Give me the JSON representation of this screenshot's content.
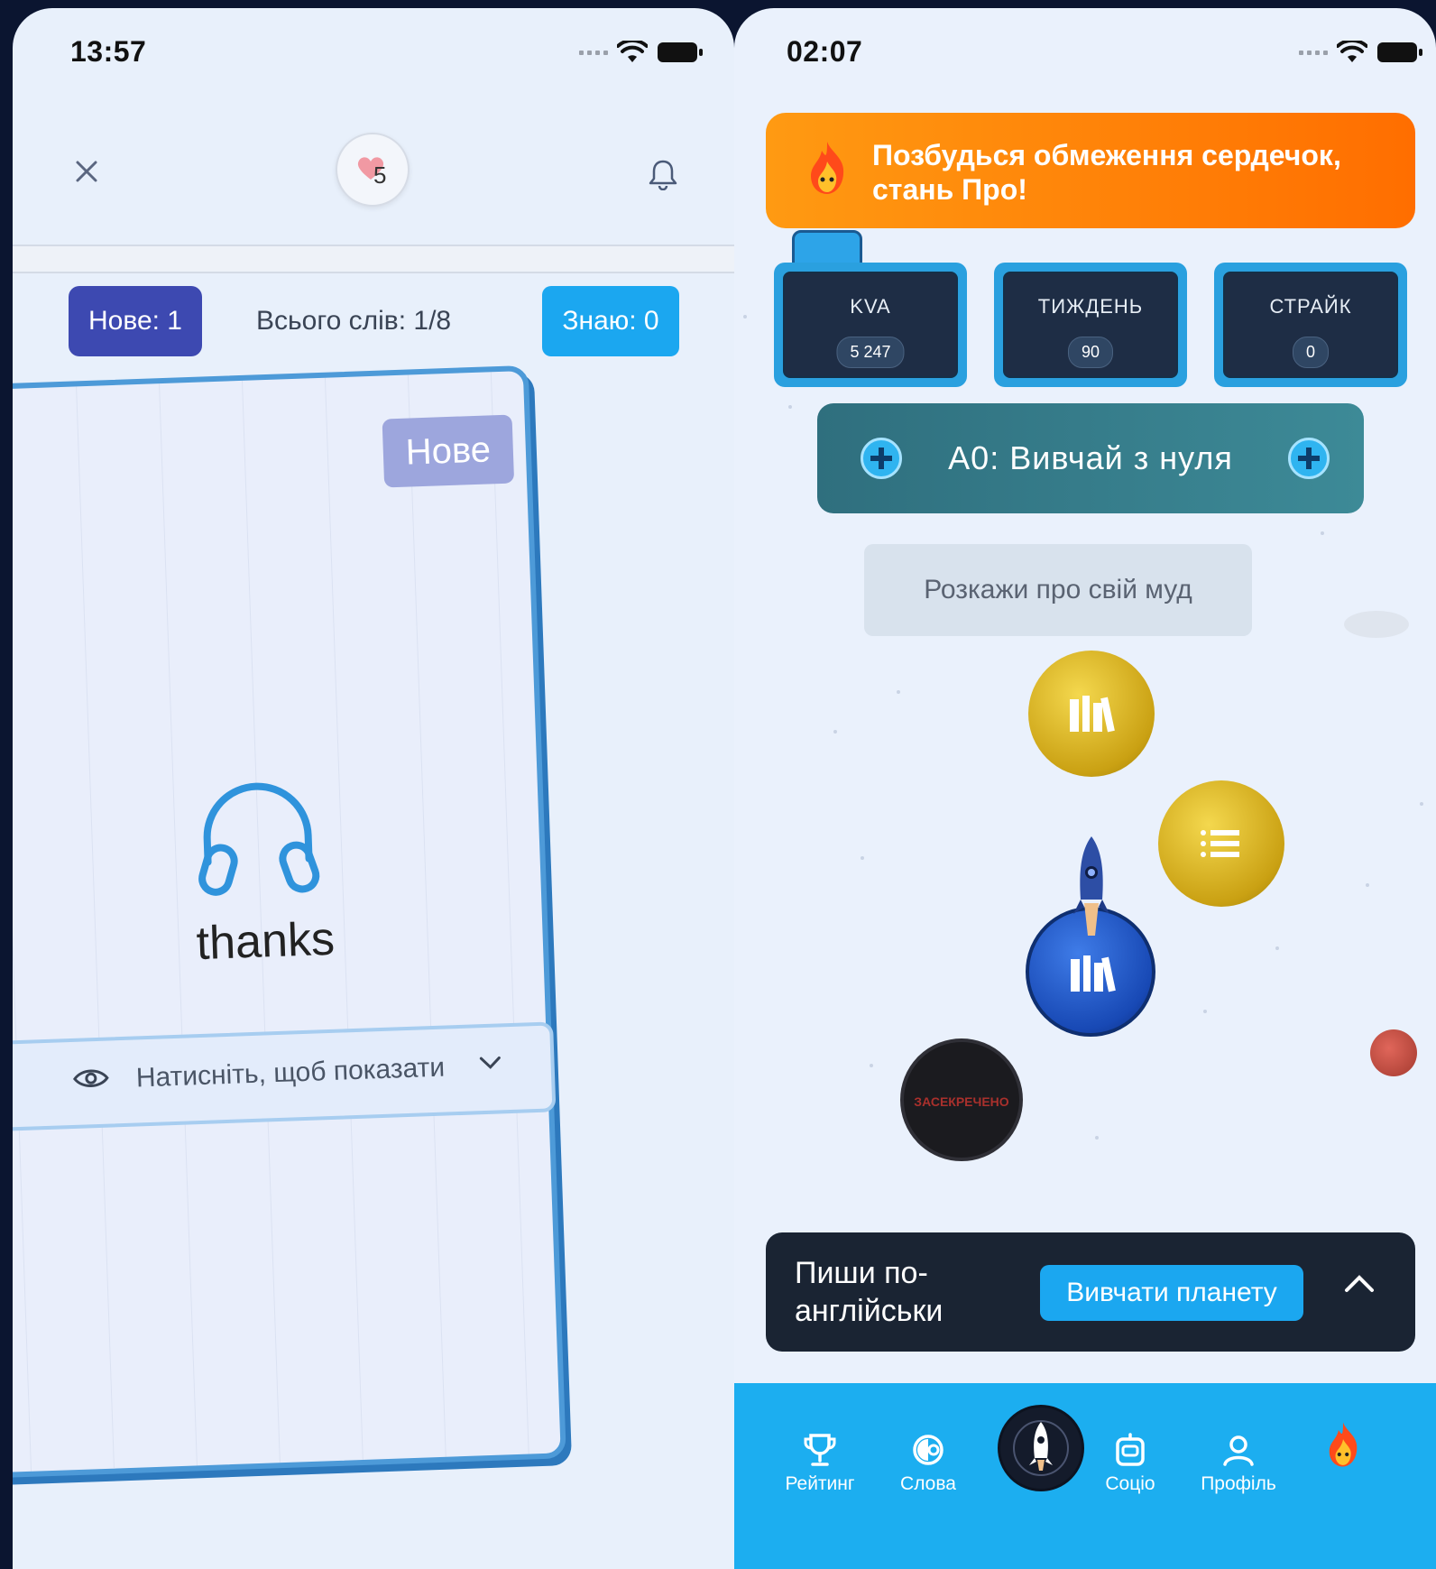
{
  "left_screen": {
    "status_time": "13:57",
    "hearts_count": "5",
    "counters": {
      "new_label": "Нове: 1",
      "total_label": "Всього слів: 1/8",
      "know_label": "Знаю: 0"
    },
    "card": {
      "badge": "Нове",
      "word": "thanks",
      "reveal_hint": "Натисніть, щоб показати"
    },
    "icons": [
      "close-icon",
      "heart-icon",
      "bell-icon",
      "headphones-icon",
      "eye-icon",
      "chevron-down-icon"
    ]
  },
  "right_screen": {
    "status_time": "02:07",
    "promo_text": "Позбудься обмеження сердечок, стань Про!",
    "stats": [
      {
        "label": "KVA",
        "value": "5 247"
      },
      {
        "label": "ТИЖДЕНЬ",
        "value": "90"
      },
      {
        "label": "СТРАЙК",
        "value": "0"
      }
    ],
    "level_title": "A0: Вивчай з нуля",
    "mood_prompt": "Розкажи про свій муд",
    "secret_label": "ЗАСЕКРЕЧЕНО",
    "task": {
      "title": "Пиши по-англійськи",
      "button_label": "Вивчати планету"
    },
    "nav": {
      "items": [
        {
          "label": "Рейтинг",
          "icon": "trophy-icon"
        },
        {
          "label": "Слова",
          "icon": "words-icon"
        },
        {
          "label": "",
          "icon": "rocket-nav-icon"
        },
        {
          "label": "Соціо",
          "icon": "socio-icon"
        },
        {
          "label": "Профіль",
          "icon": "profile-icon"
        },
        {
          "label": "",
          "icon": "flame-icon"
        }
      ]
    }
  },
  "colors": {
    "primary_blue": "#1ba7f0",
    "indigo": "#3d49b1",
    "promo_orange": "#ff7a00",
    "dark_panel": "#1a2433",
    "gold_planet": "#caa113"
  }
}
